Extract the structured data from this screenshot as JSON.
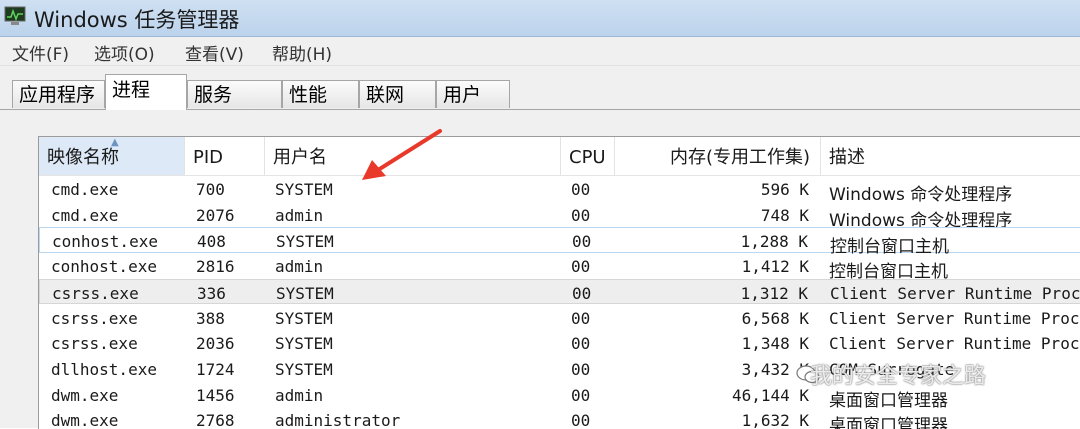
{
  "window": {
    "title": "Windows 任务管理器"
  },
  "menu": [
    "文件(F)",
    "选项(O)",
    "查看(V)",
    "帮助(H)"
  ],
  "tabs": [
    {
      "label": "应用程序",
      "active": false
    },
    {
      "label": "进程",
      "active": true
    },
    {
      "label": "服务",
      "active": false
    },
    {
      "label": "性能",
      "active": false
    },
    {
      "label": "联网",
      "active": false
    },
    {
      "label": "用户",
      "active": false
    }
  ],
  "table": {
    "columns": [
      "映像名称",
      "PID",
      "用户名",
      "CPU",
      "内存(专用工作集)",
      "描述"
    ],
    "sorted_column": "映像名称",
    "rows": [
      {
        "image": "cmd.exe",
        "pid": "700",
        "user": "SYSTEM",
        "cpu": "00",
        "mem": "596 K",
        "desc": "Windows 命令处理程序"
      },
      {
        "image": "cmd.exe",
        "pid": "2076",
        "user": "admin",
        "cpu": "00",
        "mem": "748 K",
        "desc": "Windows 命令处理程序"
      },
      {
        "image": "conhost.exe",
        "pid": "408",
        "user": "SYSTEM",
        "cpu": "00",
        "mem": "1,288 K",
        "desc": "控制台窗口主机"
      },
      {
        "image": "conhost.exe",
        "pid": "2816",
        "user": "admin",
        "cpu": "00",
        "mem": "1,412 K",
        "desc": "控制台窗口主机"
      },
      {
        "image": "csrss.exe",
        "pid": "336",
        "user": "SYSTEM",
        "cpu": "00",
        "mem": "1,312 K",
        "desc": "Client Server Runtime Proc"
      },
      {
        "image": "csrss.exe",
        "pid": "388",
        "user": "SYSTEM",
        "cpu": "00",
        "mem": "6,568 K",
        "desc": "Client Server Runtime Proc"
      },
      {
        "image": "csrss.exe",
        "pid": "2036",
        "user": "SYSTEM",
        "cpu": "00",
        "mem": "1,348 K",
        "desc": "Client Server Runtime Proc"
      },
      {
        "image": "dllhost.exe",
        "pid": "1724",
        "user": "SYSTEM",
        "cpu": "00",
        "mem": "3,432 K",
        "desc": "COM Surrogate"
      },
      {
        "image": "dwm.exe",
        "pid": "1456",
        "user": "admin",
        "cpu": "00",
        "mem": "46,144 K",
        "desc": "桌面窗口管理器"
      },
      {
        "image": "dwm.exe",
        "pid": "2768",
        "user": "administrator",
        "cpu": "00",
        "mem": "1,632 K",
        "desc": "桌面窗口管理器"
      }
    ]
  },
  "watermark": "我的安全专家之路",
  "colors": {
    "annotation_arrow": "#e8392b",
    "selection_border": "#bcd7f2",
    "titlebar": "#c4d8ee"
  }
}
